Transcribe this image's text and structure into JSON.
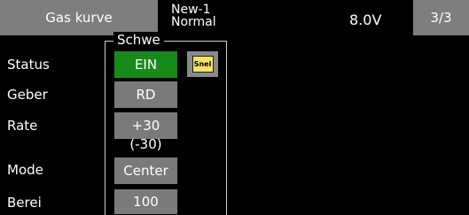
{
  "header": {
    "title": "Gas kurve",
    "model_name": "New-1",
    "condition": "Normal",
    "voltage": "8.0V",
    "page": "3/3"
  },
  "panel": {
    "group_title": "Schwe",
    "fine_icon_label": "Snel",
    "rows": [
      {
        "label": "Status",
        "value": "EIN"
      },
      {
        "label": "Geber",
        "value": "RD"
      },
      {
        "label": "Rate",
        "value": "+30",
        "sub": "(-30)"
      },
      {
        "label": "Mode",
        "value": "Center"
      },
      {
        "label": "Berei",
        "value": "100"
      }
    ]
  },
  "colors": {
    "background": "#000000",
    "tab_gray": "#7e7e7e",
    "status_on": "#178a1a",
    "fine_icon": "#f3e36a"
  }
}
